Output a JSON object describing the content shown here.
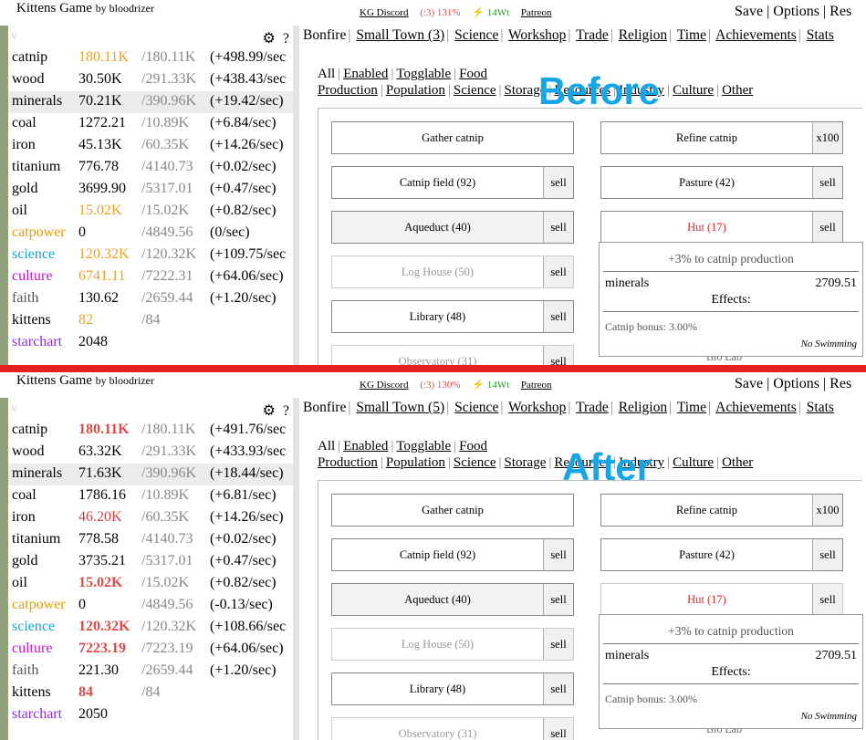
{
  "before": {
    "label": "Before",
    "topbar": {
      "title": "Kittens Game",
      "by": "by bloodrizer",
      "discord": "KG Discord",
      "happiness": "(:3) 131%",
      "energy": "⚡ 14Wt",
      "patreon": "Patreon",
      "right": "Save | Options | Res"
    },
    "resources": [
      {
        "name": "catnip",
        "value": "180.11K",
        "max": "/180.11K",
        "rate": "(+498.99/sec",
        "name_color": "#000",
        "value_color": "#f0a020",
        "bold": false
      },
      {
        "name": "wood",
        "value": "30.50K",
        "max": "/291.33K",
        "rate": "(+438.43/sec",
        "name_color": "#000",
        "value_color": "#000",
        "bold": false
      },
      {
        "name": "minerals",
        "value": "70.21K",
        "max": "/390.96K",
        "rate": "(+19.42/sec)",
        "name_color": "#000",
        "value_color": "#000",
        "bold": false
      },
      {
        "name": "coal",
        "value": "1272.21",
        "max": "/10.89K",
        "rate": "(+6.84/sec)",
        "name_color": "#000",
        "value_color": "#000",
        "bold": false
      },
      {
        "name": "iron",
        "value": "45.13K",
        "max": "/60.35K",
        "rate": "(+14.26/sec)",
        "name_color": "#000",
        "value_color": "#000",
        "bold": false
      },
      {
        "name": "titanium",
        "value": "776.78",
        "max": "/4140.73",
        "rate": "(+0.02/sec)",
        "name_color": "#000",
        "value_color": "#000",
        "bold": false
      },
      {
        "name": "gold",
        "value": "3699.90",
        "max": "/5317.01",
        "rate": "(+0.47/sec)",
        "name_color": "#000",
        "value_color": "#000",
        "bold": false
      },
      {
        "name": "oil",
        "value": "15.02K",
        "max": "/15.02K",
        "rate": "(+0.82/sec)",
        "name_color": "#000",
        "value_color": "#f0a020",
        "bold": false
      },
      {
        "name": "catpower",
        "value": "0",
        "max": "/4849.56",
        "rate": "(0/sec)",
        "name_color": "#dfa000",
        "value_color": "#000",
        "bold": false
      },
      {
        "name": "science",
        "value": "120.32K",
        "max": "/120.32K",
        "rate": "(+109.75/sec",
        "name_color": "#1aa0c8",
        "value_color": "#f0a020",
        "bold": false
      },
      {
        "name": "culture",
        "value": "6741.11",
        "max": "/7222.31",
        "rate": "(+64.06/sec)",
        "name_color": "#c018c0",
        "value_color": "#f0a020",
        "bold": false
      },
      {
        "name": "faith",
        "value": "130.62",
        "max": "/2659.44",
        "rate": "(+1.20/sec)",
        "name_color": "#555",
        "value_color": "#000",
        "bold": false
      },
      {
        "name": "kittens",
        "value": "82",
        "max": "/84",
        "rate": "",
        "name_color": "#000",
        "value_color": "#f0a020",
        "bold": false
      },
      {
        "name": "starchart",
        "value": "2048",
        "max": "",
        "rate": "",
        "name_color": "#8a2be2",
        "value_color": "#000",
        "bold": false
      }
    ],
    "tabs": {
      "bonfire": "Bonfire",
      "town": "Small Town (3)",
      "science": "Science",
      "workshop": "Workshop",
      "trade": "Trade",
      "religion": "Religion",
      "time": "Time",
      "achievements": "Achievements",
      "stats": "Stats"
    },
    "buildings": {
      "gather": "Gather catnip",
      "refine": "Refine catnip",
      "x100": "x100",
      "field": "Catnip field (92)",
      "pasture": "Pasture (42)",
      "aqueduct": "Aqueduct (40)",
      "hut": "Hut (17)",
      "loghouse": "Log House (50)",
      "library": "Library (48)",
      "observatory": "Observatory (31)",
      "sell": "sell"
    }
  },
  "after": {
    "label": "After",
    "topbar": {
      "title": "Kittens Game",
      "by": "by bloodrizer",
      "discord": "KG Discord",
      "happiness": "(:3) 130%",
      "energy": "⚡ 14Wt",
      "patreon": "Patreon",
      "right": "Save | Options | Res"
    },
    "resources": [
      {
        "name": "catnip",
        "value": "180.11K",
        "max": "/180.11K",
        "rate": "(+491.76/sec",
        "name_color": "#000",
        "value_color": "#e04a4a",
        "bold": true
      },
      {
        "name": "wood",
        "value": "63.32K",
        "max": "/291.33K",
        "rate": "(+433.93/sec",
        "name_color": "#000",
        "value_color": "#000",
        "bold": false
      },
      {
        "name": "minerals",
        "value": "71.63K",
        "max": "/390.96K",
        "rate": "(+18.44/sec)",
        "name_color": "#000",
        "value_color": "#000",
        "bold": false
      },
      {
        "name": "coal",
        "value": "1786.16",
        "max": "/10.89K",
        "rate": "(+6.81/sec)",
        "name_color": "#000",
        "value_color": "#000",
        "bold": false
      },
      {
        "name": "iron",
        "value": "46.20K",
        "max": "/60.35K",
        "rate": "(+14.26/sec)",
        "name_color": "#000",
        "value_color": "#d04040",
        "bold": false
      },
      {
        "name": "titanium",
        "value": "778.58",
        "max": "/4140.73",
        "rate": "(+0.02/sec)",
        "name_color": "#000",
        "value_color": "#000",
        "bold": false
      },
      {
        "name": "gold",
        "value": "3735.21",
        "max": "/5317.01",
        "rate": "(+0.47/sec)",
        "name_color": "#000",
        "value_color": "#000",
        "bold": false
      },
      {
        "name": "oil",
        "value": "15.02K",
        "max": "/15.02K",
        "rate": "(+0.82/sec)",
        "name_color": "#000",
        "value_color": "#e04a4a",
        "bold": true
      },
      {
        "name": "catpower",
        "value": "0",
        "max": "/4849.56",
        "rate": "(-0.13/sec)",
        "name_color": "#dfa000",
        "value_color": "#000",
        "bold": false
      },
      {
        "name": "science",
        "value": "120.32K",
        "max": "/120.32K",
        "rate": "(+108.66/sec",
        "name_color": "#1aa0c8",
        "value_color": "#e04a4a",
        "bold": true
      },
      {
        "name": "culture",
        "value": "7223.19",
        "max": "/7223.19",
        "rate": "(+64.06/sec)",
        "name_color": "#c018c0",
        "value_color": "#e04a4a",
        "bold": true
      },
      {
        "name": "faith",
        "value": "221.30",
        "max": "/2659.44",
        "rate": "(+1.20/sec)",
        "name_color": "#555",
        "value_color": "#000",
        "bold": false
      },
      {
        "name": "kittens",
        "value": "84",
        "max": "/84",
        "rate": "",
        "name_color": "#000",
        "value_color": "#e04a4a",
        "bold": true
      },
      {
        "name": "starchart",
        "value": "2050",
        "max": "",
        "rate": "",
        "name_color": "#8a2be2",
        "value_color": "#000",
        "bold": false
      }
    ],
    "tabs": {
      "bonfire": "Bonfire",
      "town": "Small Town (5)",
      "science": "Science",
      "workshop": "Workshop",
      "trade": "Trade",
      "religion": "Religion",
      "time": "Time",
      "achievements": "Achievements",
      "stats": "Stats"
    },
    "buildings": {
      "gather": "Gather catnip",
      "refine": "Refine catnip",
      "x100": "x100",
      "field": "Catnip field (92)",
      "pasture": "Pasture (42)",
      "aqueduct": "Aqueduct (40)",
      "hut": "Hut (17)",
      "loghouse": "Log House (50)",
      "library": "Library (48)",
      "observatory": "Observatory (31)",
      "sell": "sell"
    }
  },
  "filters": [
    "All",
    "Enabled",
    "Togglable",
    "Food Production",
    "Population",
    "Science",
    "Storage",
    "Resources",
    "Industry",
    "Culture",
    "Other"
  ],
  "tooltip": {
    "title": "+3% to catnip production",
    "res_name": "minerals",
    "res_value": "2709.51",
    "effects": "Effects:",
    "bonus": "Catnip bonus: 3.00%",
    "flavor": "No Swimming"
  },
  "bio_lab": "Bio Lab",
  "left_head": {
    "v": "v",
    "gear": "⚙",
    "help": "?"
  },
  "colors": {
    "divider": "#e1201f",
    "label": "#16a5e6"
  }
}
